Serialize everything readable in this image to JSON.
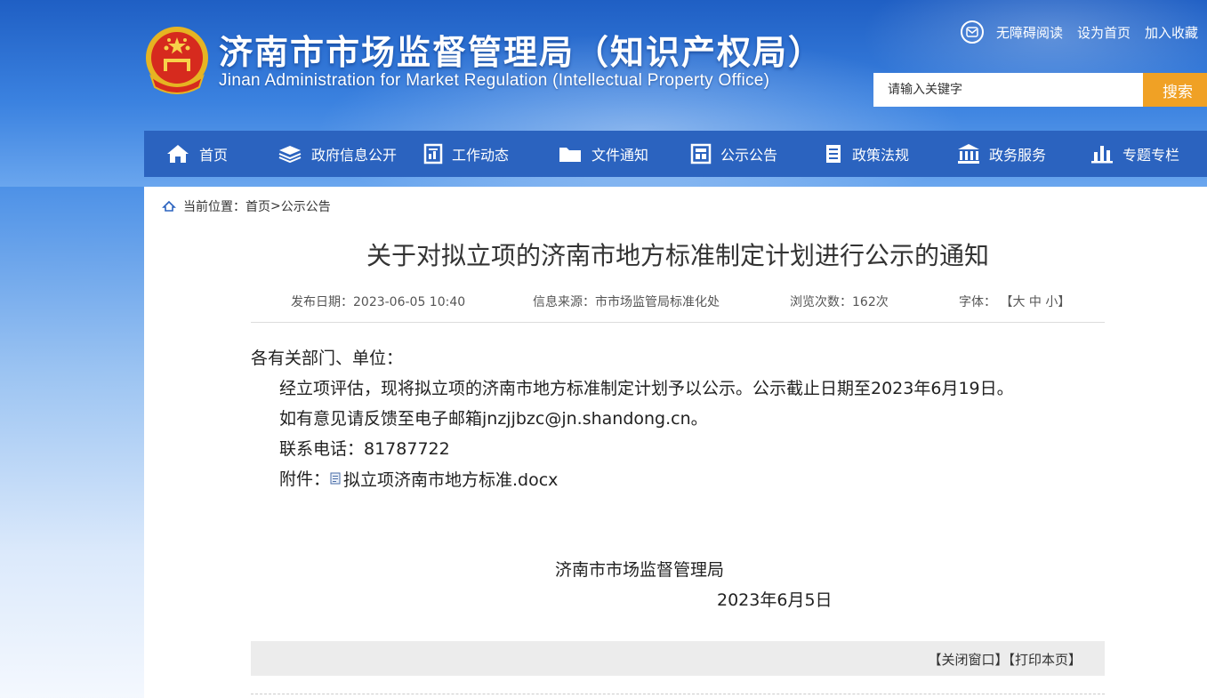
{
  "header": {
    "title": "济南市市场监督管理局（知识产权局）",
    "subtitle": "Jinan Administration for Market Regulation (Intellectual Property Office)",
    "toplinks": [
      "无障碍阅读",
      "设为首页",
      "加入收藏"
    ],
    "search": {
      "placeholder": "请输入关键字",
      "button": "搜索"
    }
  },
  "nav": {
    "items": [
      {
        "label": "首页",
        "icon": "home-icon"
      },
      {
        "label": "政府信息公开",
        "icon": "layers-icon"
      },
      {
        "label": "工作动态",
        "icon": "document-chart-icon"
      },
      {
        "label": "文件通知",
        "icon": "folder-icon"
      },
      {
        "label": "公示公告",
        "icon": "bulletin-icon"
      },
      {
        "label": "政策法规",
        "icon": "book-icon"
      },
      {
        "label": "政务服务",
        "icon": "government-building-icon"
      },
      {
        "label": "专题专栏",
        "icon": "bar-chart-icon"
      }
    ]
  },
  "breadcrumb": {
    "prefix": "当前位置：",
    "home": "首页",
    "sep": ">",
    "current": "公示公告"
  },
  "article": {
    "title": "关于对拟立项的济南市地方标准制定计划进行公示的通知",
    "meta": {
      "date_label": "发布日期：",
      "date": "2023-06-05 10:40",
      "source_label": "信息来源：",
      "source": "市市场监管局标准化处",
      "views_label": "浏览次数：",
      "views": "162次",
      "font_label": "字体：",
      "font_open": "【",
      "font_large": "大",
      "font_medium": "中",
      "font_small": "小",
      "font_close": "】"
    },
    "greeting": "各有关部门、单位：",
    "paragraph1": "经立项评估，现将拟立项的济南市地方标准制定计划予以公示。公示截止日期至2023年6月19日。",
    "paragraph2": "如有意见请反馈至电子邮箱jnzjjbzc@jn.shandong.cn。",
    "phone": "联系电话：81787722",
    "attachment_label": "附件：",
    "attachment_name": "拟立项济南市地方标准.docx",
    "signature_org": "济南市市场监督管理局",
    "signature_date": "2023年6月5日"
  },
  "footer": {
    "close": "【关闭窗口】",
    "print": "【打印本页】"
  },
  "colors": {
    "nav_bg": "#2b63bf",
    "search_button": "#f0a125",
    "header_blue": "#1f5fc4"
  }
}
